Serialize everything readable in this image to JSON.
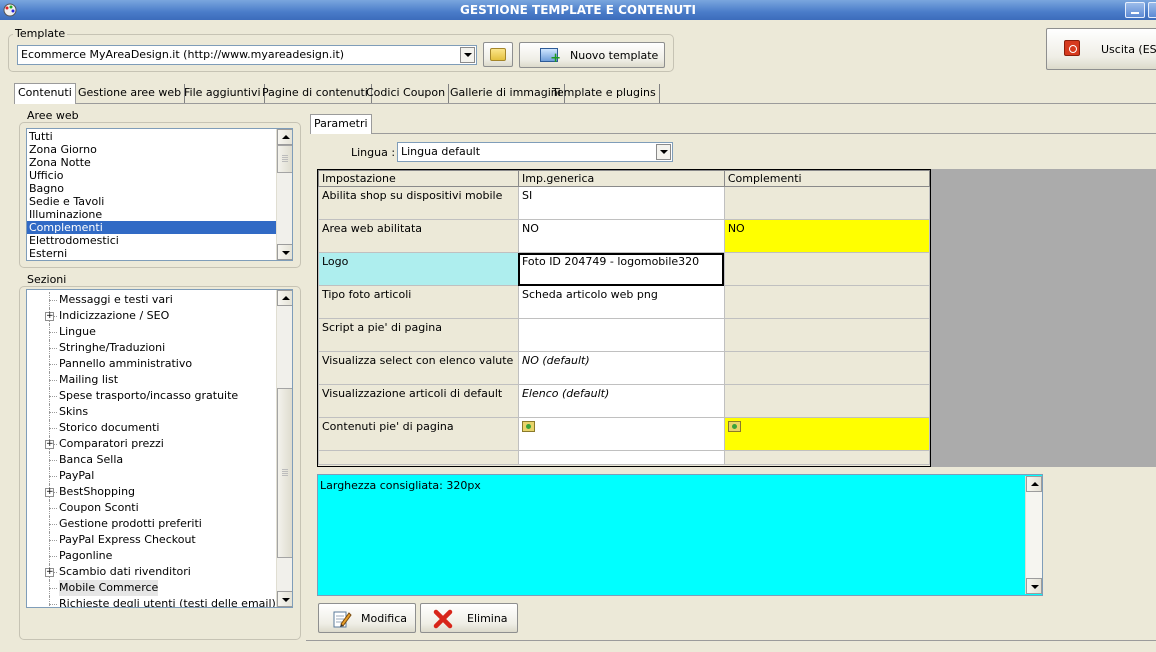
{
  "window": {
    "title": "GESTIONE TEMPLATE E CONTENUTI"
  },
  "template_group": {
    "label": "Template",
    "selected": "Ecommerce MyAreaDesign.it (http://www.myareadesign.it)",
    "new_template_label": "Nuovo template"
  },
  "exit_button": {
    "label": "Uscita (ESC)"
  },
  "tabs": [
    {
      "label": "Contenuti",
      "active": true
    },
    {
      "label": "Gestione aree web"
    },
    {
      "label": "File aggiuntivi"
    },
    {
      "label": "Pagine di contenuti"
    },
    {
      "label": "Codici Coupon"
    },
    {
      "label": "Gallerie di immagini"
    },
    {
      "label": "Template e plugins"
    }
  ],
  "aree_web": {
    "label": "Aree web",
    "items": [
      "Tutti",
      "Zona Giorno",
      "Zona Notte",
      "Ufficio",
      "Bagno",
      "Sedie e Tavoli",
      "Illuminazione",
      "Complementi",
      "Elettrodomestici",
      "Esterni"
    ],
    "selected": "Complementi"
  },
  "sezioni": {
    "label": "Sezioni",
    "items": [
      {
        "label": "Messaggi e testi vari",
        "expandable": false
      },
      {
        "label": "Indicizzazione / SEO",
        "expandable": true
      },
      {
        "label": "Lingue",
        "expandable": false
      },
      {
        "label": "Stringhe/Traduzioni",
        "expandable": false
      },
      {
        "label": "Pannello amministrativo",
        "expandable": false
      },
      {
        "label": "Mailing list",
        "expandable": false
      },
      {
        "label": "Spese trasporto/incasso gratuite",
        "expandable": false
      },
      {
        "label": "Skins",
        "expandable": false
      },
      {
        "label": "Storico documenti",
        "expandable": false
      },
      {
        "label": "Comparatori prezzi",
        "expandable": true
      },
      {
        "label": "Banca Sella",
        "expandable": false
      },
      {
        "label": "PayPal",
        "expandable": false
      },
      {
        "label": "BestShopping",
        "expandable": true
      },
      {
        "label": "Coupon Sconti",
        "expandable": false
      },
      {
        "label": "Gestione prodotti preferiti",
        "expandable": false
      },
      {
        "label": "PayPal Express Checkout",
        "expandable": false
      },
      {
        "label": "Pagonline",
        "expandable": false
      },
      {
        "label": "Scambio dati rivenditori",
        "expandable": true
      },
      {
        "label": "Mobile Commerce",
        "expandable": false,
        "selected": true
      },
      {
        "label": "Richieste degli utenti (testi delle email)",
        "expandable": false
      }
    ]
  },
  "parametri": {
    "tab_label": "Parametri",
    "lingua_label": "Lingua :",
    "lingua_value": "Lingua default",
    "columns": [
      "Impostazione",
      "Imp.generica",
      "Complementi"
    ],
    "rows": [
      {
        "setting": "Abilita shop su dispositivi mobile",
        "generic": "SI",
        "comp": ""
      },
      {
        "setting": "Area web abilitata",
        "generic": "NO",
        "comp": "NO",
        "comp_highlight": true
      },
      {
        "setting": "Logo",
        "generic": "Foto ID 204749 - logomobile320",
        "comp": "",
        "selected": true
      },
      {
        "setting": "Tipo foto articoli",
        "generic": "Scheda articolo web png",
        "comp": ""
      },
      {
        "setting": "Script a pie' di pagina",
        "generic": "",
        "comp": ""
      },
      {
        "setting": "Visualizza select con elenco valute",
        "generic": "NO (default)",
        "comp": "",
        "italic": true
      },
      {
        "setting": "Visualizzazione articoli di default",
        "generic": "Elenco (default)",
        "comp": "",
        "italic": true
      },
      {
        "setting": "Contenuti pie' di pagina",
        "generic": "",
        "comp": "",
        "generic_icon": true,
        "comp_icon": true,
        "comp_highlight": true
      }
    ],
    "description": "Larghezza consigliata: 320px"
  },
  "actions": {
    "modifica_label": "Modifica",
    "elimina_label": "Elimina"
  }
}
